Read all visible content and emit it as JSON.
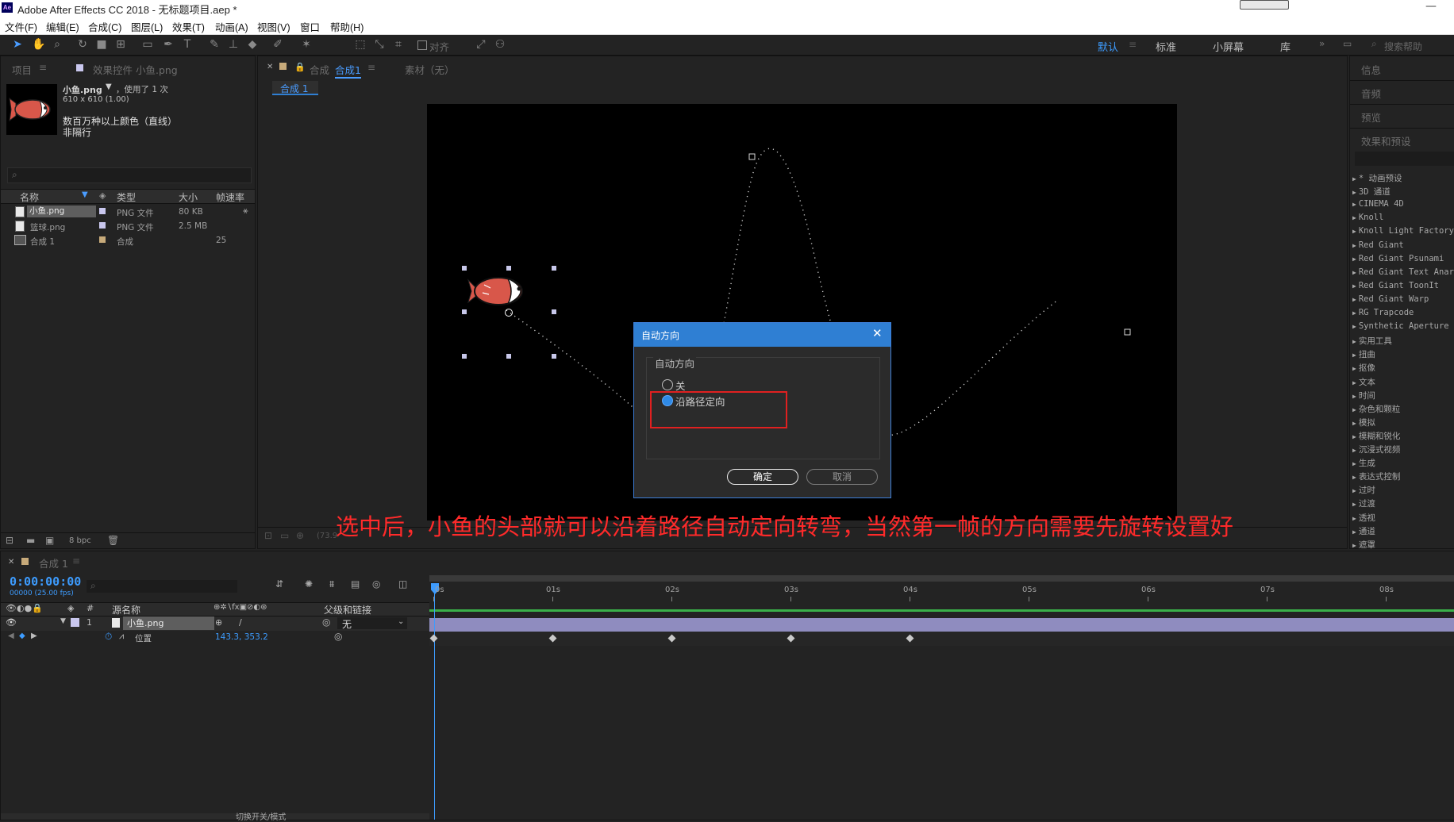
{
  "window": {
    "title": "Adobe After Effects CC 2018 - 无标题项目.aep *",
    "app_icon": "Ae"
  },
  "menu": [
    "文件(F)",
    "编辑(E)",
    "合成(C)",
    "图层(L)",
    "效果(T)",
    "动画(A)",
    "视图(V)",
    "窗口",
    "帮助(H)"
  ],
  "toolbar": {
    "align_label": "对齐",
    "workspaces": [
      "默认",
      "标准",
      "小屏幕",
      "库"
    ],
    "active_workspace": "默认",
    "search_placeholder": "搜索帮助"
  },
  "project_panel": {
    "tab_project": "项目",
    "tab_effects": "效果控件 小鱼.png",
    "item_name": "小鱼.png",
    "used_text": "，使用了 1 次",
    "dimensions": "610 x 610 (1.00)",
    "color_info": "数百万种以上颜色（直线）",
    "interlace": "非隔行",
    "columns": {
      "name": "名称",
      "type": "类型",
      "size": "大小",
      "fps": "帧速率"
    },
    "items": [
      {
        "name": "小鱼.png",
        "type": "PNG 文件",
        "size": "80 KB",
        "fps": ""
      },
      {
        "name": "篮球.png",
        "type": "PNG 文件",
        "size": "2.5 MB",
        "fps": ""
      },
      {
        "name": "合成 1",
        "type": "合成",
        "size": "",
        "fps": "25"
      }
    ],
    "bpc": "8 bpc"
  },
  "comp_panel": {
    "tab_comp_prefix": "合成",
    "tab_comp_name": "合成1",
    "tab_footage": "素材（无）",
    "breadcrumb": "合成 1",
    "zoom_fragment": "(73.9"
  },
  "dialog": {
    "title": "自动方向",
    "group_label": "自动方向",
    "options": [
      {
        "label": "关",
        "selected": false
      },
      {
        "label": "沿路径定向",
        "selected": true
      }
    ],
    "ok_label": "确定",
    "cancel_label": "取消"
  },
  "annotation": {
    "text": "选中后，小鱼的头部就可以沿着路径自动定向转弯，当然第一帧的方向需要先旋转设置好",
    "color": "#ff2a2a"
  },
  "right_panel": {
    "sections": [
      "信息",
      "音频",
      "预览",
      "效果和预设"
    ],
    "effects": [
      "* 动画预设",
      "3D 通道",
      "CINEMA 4D",
      "Knoll",
      "Knoll Light Factory",
      "Red Giant",
      "Red Giant Psunami",
      "Red Giant Text Anarchy",
      "Red Giant ToonIt",
      "Red Giant Warp",
      "RG Trapcode",
      "Synthetic Aperture",
      "实用工具",
      "扭曲",
      "抠像",
      "文本",
      "时间",
      "杂色和颗粒",
      "模拟",
      "模糊和锐化",
      "沉浸式视频",
      "生成",
      "表达式控制",
      "过时",
      "过渡",
      "透视",
      "通道",
      "遮罩"
    ]
  },
  "timeline": {
    "tab_label": "合成 1",
    "timecode": "0:00:00:00",
    "frames_info": "00000 (25.00 fps)",
    "col_source": "源名称",
    "col_parent": "父级和链接",
    "layer": {
      "index": "1",
      "name": "小鱼.png",
      "parent": "无"
    },
    "property": {
      "name": "位置",
      "value": "143.3, 353.2"
    },
    "ticks": [
      "0s",
      "01s",
      "02s",
      "03s",
      "04s",
      "05s",
      "06s",
      "07s",
      "08s"
    ],
    "keyframe_seconds": [
      0,
      1,
      2,
      3,
      4
    ],
    "bottom_toggle": "切换开关/模式"
  },
  "colors": {
    "accent": "#2f7fd3",
    "timecode": "#3d9cff",
    "layer_bar": "#8f8cbf",
    "highlight_box": "#e02020"
  }
}
